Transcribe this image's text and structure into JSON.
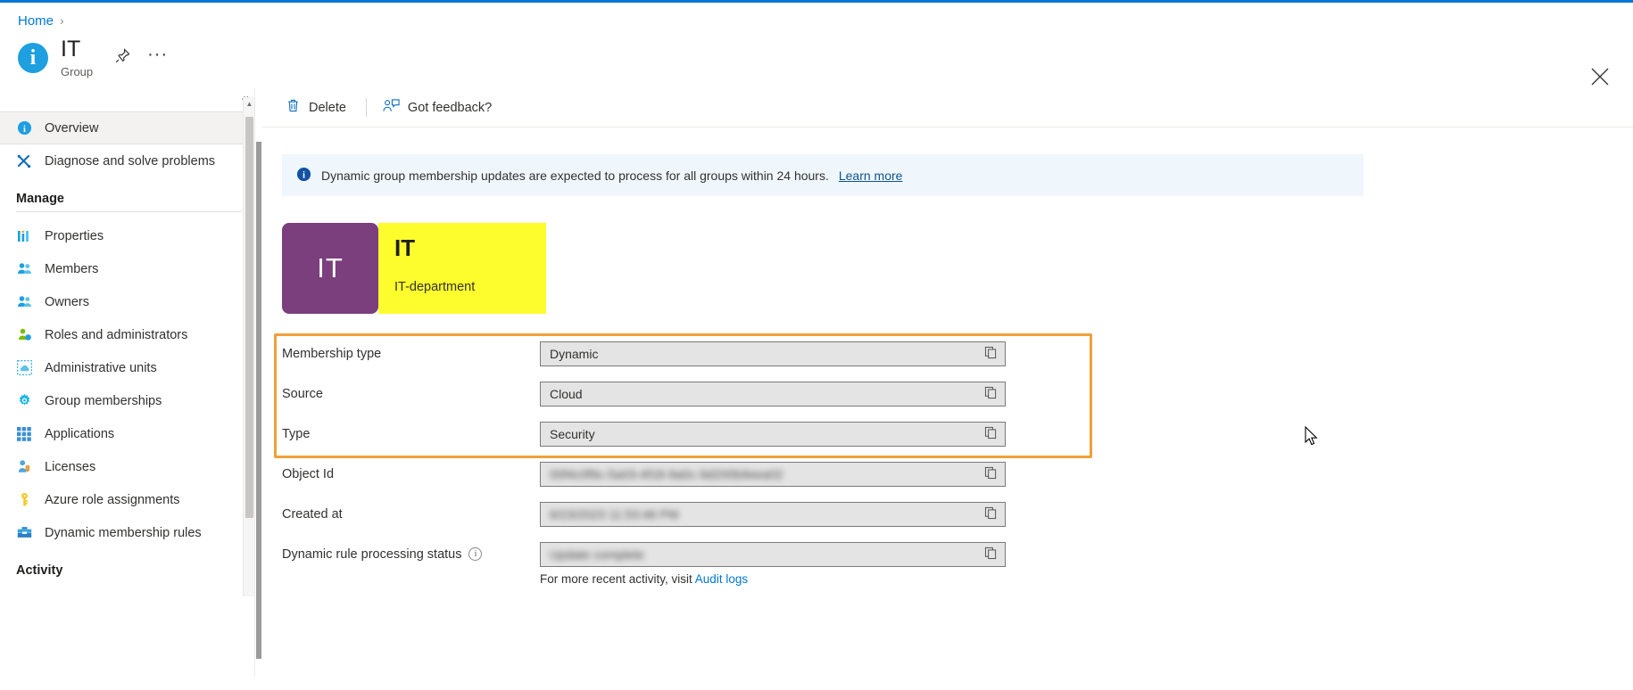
{
  "breadcrumb": {
    "home": "Home",
    "separator": "›"
  },
  "blade": {
    "avatar_letter": "i",
    "title": "IT",
    "subtitle": "Group",
    "pin_icon": "pin-icon",
    "more_label": "···",
    "close_icon": "close-icon"
  },
  "toolbar": {
    "delete_label": "Delete",
    "feedback_label": "Got feedback?"
  },
  "banner": {
    "text": "Dynamic group membership updates are expected to process for all groups within 24 hours.",
    "link_label": "Learn more"
  },
  "group": {
    "initials": "IT",
    "name": "IT",
    "description": "IT-department",
    "avatar_color": "#7b3f7d",
    "highlight_color": "#fdfd2e"
  },
  "sidebar": {
    "collapse_icon": "«",
    "items": [
      {
        "label": "Overview",
        "icon": "info-icon",
        "selected": true
      },
      {
        "label": "Diagnose and solve problems",
        "icon": "wrench-screwdriver-icon",
        "selected": false
      }
    ],
    "manage_section": "Manage",
    "manage_items": [
      {
        "label": "Properties",
        "icon": "properties-bars-icon"
      },
      {
        "label": "Members",
        "icon": "members-people-icon"
      },
      {
        "label": "Owners",
        "icon": "owners-people-icon"
      },
      {
        "label": "Roles and administrators",
        "icon": "roles-person-icon"
      },
      {
        "label": "Administrative units",
        "icon": "administrative-units-icon"
      },
      {
        "label": "Group memberships",
        "icon": "gear-icon"
      },
      {
        "label": "Applications",
        "icon": "applications-grid-icon"
      },
      {
        "label": "Licenses",
        "icon": "licenses-badge-icon"
      },
      {
        "label": "Azure role assignments",
        "icon": "key-icon"
      },
      {
        "label": "Dynamic membership rules",
        "icon": "toolbox-icon"
      }
    ],
    "activity_section": "Activity"
  },
  "properties": {
    "highlighted": [
      {
        "label": "Membership type",
        "value": "Dynamic"
      },
      {
        "label": "Source",
        "value": "Cloud"
      },
      {
        "label": "Type",
        "value": "Security"
      }
    ],
    "rest": [
      {
        "label": "Object Id",
        "value": "00f4c0f9c-5a03-4f18-9a0c-9d200b9eea02",
        "redacted": true,
        "info": false
      },
      {
        "label": "Created at",
        "value": "6/23/2023  11:53:46 PM",
        "redacted": true,
        "info": false
      },
      {
        "label": "Dynamic rule processing status",
        "value": "Update complete",
        "redacted": true,
        "info": true
      }
    ],
    "footer_note_prefix": "For more recent activity, visit ",
    "footer_note_link": "Audit logs",
    "copy_icon": "copy-icon"
  },
  "colors": {
    "accent": "#0078d4",
    "highlight_border": "#efa039",
    "banner_bg": "#eff6fc"
  }
}
